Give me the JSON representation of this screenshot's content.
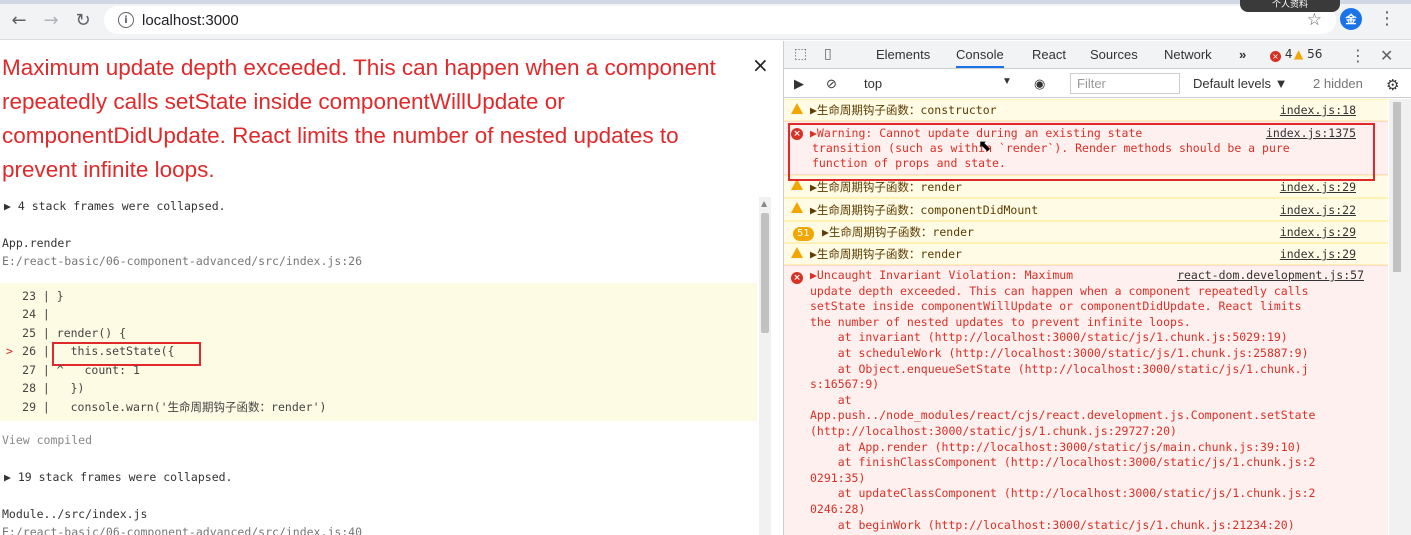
{
  "browser": {
    "url": "localhost:3000",
    "profile_chip": "个人资料",
    "extension_badge": "金"
  },
  "overlay": {
    "error_title": "Maximum update depth exceeded. This can happen when a component repeatedly calls setState inside componentWillUpdate or componentDidUpdate. React limits the number of nested updates to prevent infinite loops.",
    "close": "×",
    "collapsed_1": "▶ 4 stack frames were collapsed.",
    "frame_fn": "App.render",
    "frame_path": "E:/react-basic/06-component-advanced/src/index.js:26",
    "code": [
      {
        "marker": "",
        "num": "23",
        "code": " }"
      },
      {
        "marker": "",
        "num": "24",
        "code": ""
      },
      {
        "marker": "",
        "num": "25",
        "code": " render() {"
      },
      {
        "marker": ">",
        "num": "26",
        "code": "   this.setState({"
      },
      {
        "marker": "",
        "num": "27",
        "code": " ^   count: 1"
      },
      {
        "marker": "",
        "num": "28",
        "code": "   })"
      },
      {
        "marker": "",
        "num": "29",
        "code": "   console.warn('生命周期钩子函数：render')"
      }
    ],
    "view_compiled": "View compiled",
    "collapsed_2": "▶ 19 stack frames were collapsed.",
    "frame2_fn": "Module../src/index.js",
    "frame2_path": "E:/react-basic/06-component-advanced/src/index.js:40"
  },
  "devtools": {
    "tabs": [
      "Elements",
      "Console",
      "React",
      "Sources",
      "Network"
    ],
    "more_tabs": "»",
    "error_count": "4",
    "warning_count": "56",
    "context": "top",
    "filter_placeholder": "Filter",
    "levels": "Default levels ▼",
    "hidden": "2 hidden"
  },
  "console": {
    "messages": [
      {
        "level": "warn",
        "text": "▶生命周期钩子函数：constructor",
        "src": "index.js:18"
      },
      {
        "level": "error",
        "lines": [
          "▶Warning: Cannot update during an existing state",
          "transition (such as within `render`). Render methods should be a pure",
          "function of props and state."
        ],
        "src": "index.js:1375"
      },
      {
        "level": "warn",
        "text": "▶生命周期钩子函数：render",
        "src": "index.js:29"
      },
      {
        "level": "warn",
        "text": "▶生命周期钩子函数：componentDidMount",
        "src": "index.js:22"
      },
      {
        "level": "warn",
        "count": "51",
        "text": "▶生命周期钩子函数：render",
        "src": "index.js:29"
      },
      {
        "level": "warn",
        "text": "▶生命周期钩子函数：render",
        "src": "index.js:29"
      }
    ],
    "uncaught": {
      "src": "react-dom.development.js:57",
      "lines": [
        "▶Uncaught Invariant Violation: Maximum",
        "update depth exceeded. This can happen when a component repeatedly calls",
        "setState inside componentWillUpdate or componentDidUpdate. React limits",
        "the number of nested updates to prevent infinite loops.",
        "    at invariant (http://localhost:3000/static/js/1.chunk.js:5029:19)",
        "    at scheduleWork (http://localhost:3000/static/js/1.chunk.js:25887:9)",
        "    at Object.enqueueSetState (http://localhost:3000/static/js/1.chunk.j",
        "s:16567:9)",
        "    at",
        "App.push../node_modules/react/cjs/react.development.js.Component.setState",
        "(http://localhost:3000/static/js/1.chunk.js:29727:20)",
        "    at App.render (http://localhost:3000/static/js/main.chunk.js:39:10)",
        "    at finishClassComponent (http://localhost:3000/static/js/1.chunk.js:2",
        "0291:35)",
        "    at updateClassComponent (http://localhost:3000/static/js/1.chunk.js:2",
        "0246:28)",
        "    at beginWork (http://localhost:3000/static/js/1.chunk.js:21234:20)"
      ]
    }
  }
}
